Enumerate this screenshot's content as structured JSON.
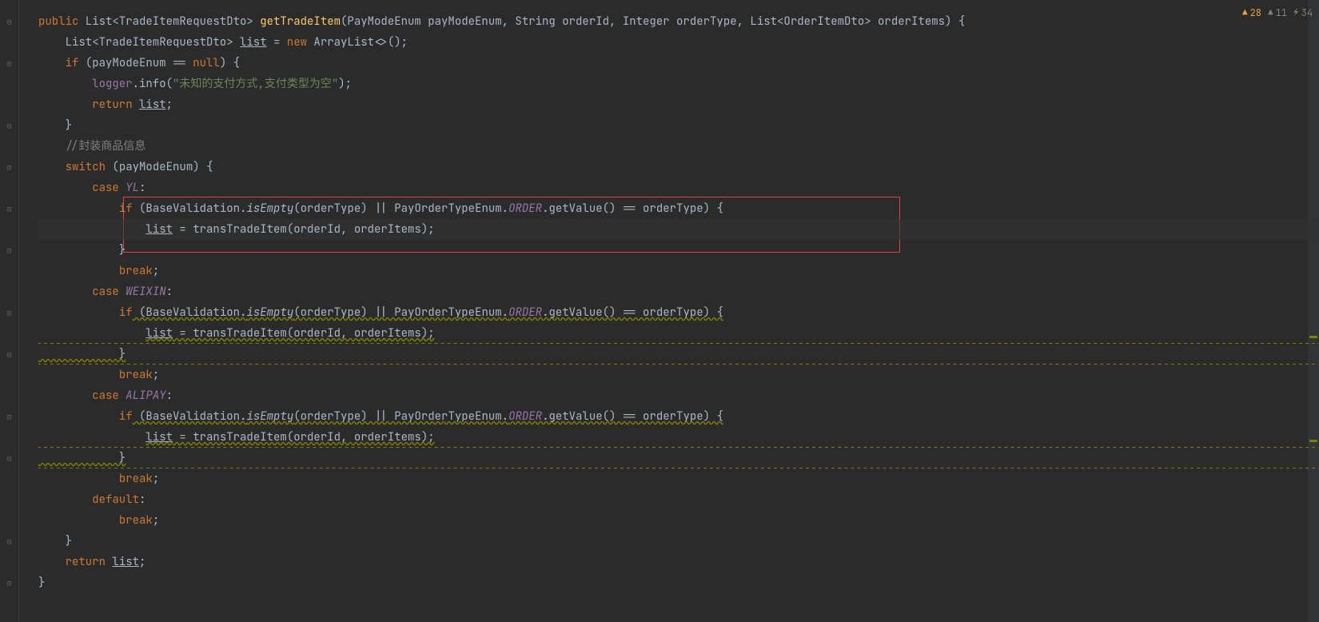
{
  "badges": {
    "warn28": "28",
    "warn11": "11",
    "check34": "34"
  },
  "code": {
    "l1": {
      "kw_public": "public",
      "type1": " List<TradeItemRequestDto> ",
      "method": "getTradeItem",
      "params": "(PayModeEnum payModeEnum, String orderId, Integer orderType, List<OrderItemDto> orderItems) {"
    },
    "l2": {
      "pre": "    List<TradeItemRequestDto> ",
      "listvar": "list",
      "mid": " = ",
      "kw_new": "new",
      "post": " ArrayList<>();"
    },
    "l3": {
      "kw_if": "if",
      "cond": " (payModeEnum == ",
      "kw_null": "null",
      "post": ") {"
    },
    "l4": {
      "pre": "        ",
      "logger": "logger",
      "dot": ".info(",
      "str": "\"未知的支付方式,支付类型为空\"",
      "post": ");"
    },
    "l5": {
      "pre": "        ",
      "kw_return": "return",
      "sp": " ",
      "listvar": "list",
      "post": ";"
    },
    "l6": {
      "txt": "    }"
    },
    "l7": {
      "comment": "    //封装商品信息"
    },
    "l8": {
      "pre": "    ",
      "kw_switch": "switch",
      "post": " (payModeEnum) {"
    },
    "l9": {
      "pre": "        ",
      "kw_case": "case",
      "sp": " ",
      "enumv": "YL",
      "post": ":"
    },
    "l10": {
      "pre": "            ",
      "kw_if": "if",
      "paren1": " (BaseValidation.",
      "isempty": "isEmpty",
      "paren2": "(orderType) || PayOrderTypeEnum.",
      "order": "ORDER",
      "paren3": ".getValue() == orderType) {"
    },
    "l11": {
      "pre": "                ",
      "listvar": "list",
      "mid": " = transTradeItem(orderId, orderItems);"
    },
    "l12": {
      "txt": "            }"
    },
    "l13": {
      "pre": "            ",
      "kw_break": "break",
      "post": ";"
    },
    "l14": {
      "pre": "        ",
      "kw_case": "case",
      "sp": " ",
      "enumv": "WEIXIN",
      "post": ":"
    },
    "l15": {
      "pre": "            ",
      "kw_if": "if",
      "paren1": " (BaseValidation.",
      "isempty": "isEmpty",
      "paren2": "(orderType) || PayOrderTypeEnum.",
      "order": "ORDER",
      "paren3": ".getValue() == orderType) {"
    },
    "l16": {
      "pre": "                ",
      "listvar": "list",
      "mid": " = transTradeItem(orderId, orderItems);"
    },
    "l17": {
      "txt": "            }"
    },
    "l18": {
      "pre": "            ",
      "kw_break": "break",
      "post": ";"
    },
    "l19": {
      "pre": "        ",
      "kw_case": "case",
      "sp": " ",
      "enumv": "ALIPAY",
      "post": ":"
    },
    "l20": {
      "pre": "            ",
      "kw_if": "if",
      "paren1": " (BaseValidation.",
      "isempty": "isEmpty",
      "paren2": "(orderType) || PayOrderTypeEnum.",
      "order": "ORDER",
      "paren3": ".getValue() == orderType) {"
    },
    "l21": {
      "pre": "                ",
      "listvar": "list",
      "mid": " = transTradeItem(orderId, orderItems);"
    },
    "l22": {
      "txt": "            }"
    },
    "l23": {
      "pre": "            ",
      "kw_break": "break",
      "post": ";"
    },
    "l24": {
      "pre": "        ",
      "kw_default": "default",
      "post": ":"
    },
    "l25": {
      "pre": "            ",
      "kw_break": "break",
      "post": ";"
    },
    "l26": {
      "txt": "    }"
    },
    "l27": {
      "pre": "    ",
      "kw_return": "return",
      "sp": " ",
      "listvar": "list",
      "post": ";"
    },
    "l28": {
      "txt": "}"
    }
  }
}
